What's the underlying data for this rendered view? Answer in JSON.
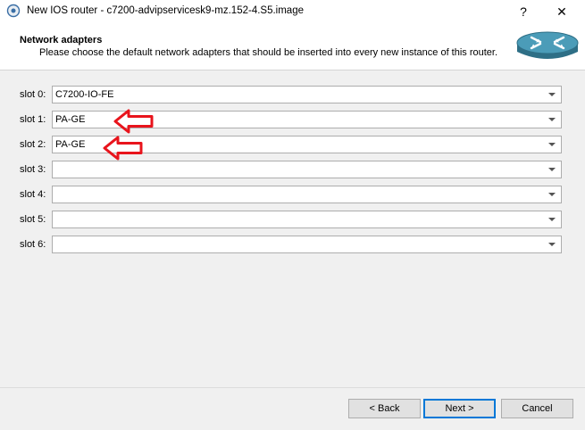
{
  "window": {
    "title": "New IOS router - c7200-advipservicesk9-mz.152-4.S5.image",
    "help_glyph": "?",
    "close_glyph": "✕"
  },
  "header": {
    "title": "Network adapters",
    "subtitle": "Please choose the default network adapters that should be inserted into every new instance of this router."
  },
  "slots": [
    {
      "label": "slot 0:",
      "value": "C7200-IO-FE"
    },
    {
      "label": "slot 1:",
      "value": "PA-GE"
    },
    {
      "label": "slot 2:",
      "value": "PA-GE"
    },
    {
      "label": "slot 3:",
      "value": ""
    },
    {
      "label": "slot 4:",
      "value": ""
    },
    {
      "label": "slot 5:",
      "value": ""
    },
    {
      "label": "slot 6:",
      "value": ""
    }
  ],
  "footer": {
    "back_label": "< Back",
    "next_label": "Next >",
    "cancel_label": "Cancel"
  },
  "icons": {
    "app": "gns3-app-icon",
    "router": "router-icon",
    "annotation": "red-arrow-icon"
  },
  "colors": {
    "annotation_arrow": "#e8141c",
    "router_body": "#3f8fa8",
    "default_button_border": "#0078d7"
  }
}
